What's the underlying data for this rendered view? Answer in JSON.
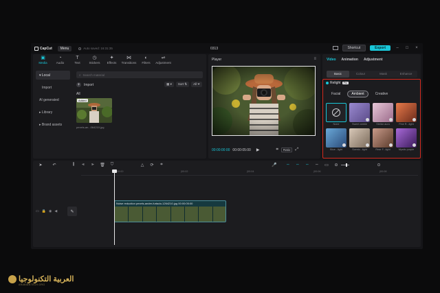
{
  "titlebar": {
    "app_name": "CapCut",
    "menu_label": "Menu",
    "autosave_text": "Auto saved: 16:31:35",
    "project_name": "0313",
    "shortcut_label": "Shortcut",
    "export_label": "Export"
  },
  "media": {
    "tabs": [
      {
        "label": "Media",
        "icon": "media-icon"
      },
      {
        "label": "Audio",
        "icon": "audio-icon"
      },
      {
        "label": "Text",
        "icon": "text-icon"
      },
      {
        "label": "Stickers",
        "icon": "sticker-icon"
      },
      {
        "label": "Effects",
        "icon": "effects-icon"
      },
      {
        "label": "Transitions",
        "icon": "transitions-icon"
      },
      {
        "label": "Filters",
        "icon": "filters-icon"
      },
      {
        "label": "Adjustment",
        "icon": "adjustment-icon"
      }
    ],
    "sidebar": [
      "Local",
      "Import",
      "AI generated",
      "Library",
      "Brand assets"
    ],
    "search_placeholder": "Search material",
    "import_label": "Import",
    "sort_label": "Sort",
    "all_filter_label": "All",
    "all_label": "All",
    "thumb_badge": "Added",
    "thumb_name": "pexels-an...064210.jpg"
  },
  "player": {
    "title": "Player",
    "timecode_current": "00:00:00:00",
    "timecode_total": "00:00:05:00",
    "ratio_label": "Ratio"
  },
  "right_panel": {
    "tabs": [
      "Video",
      "Animation",
      "Adjustment"
    ],
    "subtabs": [
      "Basic",
      "Colour",
      "Mask",
      "Enhance"
    ],
    "relight_label": "Relight",
    "relight_badge": "Pro",
    "modes": [
      "Facial",
      "Ambient",
      "Creative"
    ],
    "presets": [
      {
        "label": "None",
        "color": "#222226"
      },
      {
        "label": "Sweet  ambie",
        "color": "#7a6aa8"
      },
      {
        "label": "Stellar  aura",
        "color": "#c89ab8"
      },
      {
        "label": "Fine R...light",
        "color": "#c85a3a"
      },
      {
        "label": "Blue...light",
        "color": "#4a7aa8"
      },
      {
        "label": "Scenic...light",
        "color": "#b8a89a"
      },
      {
        "label": "Rear F...light",
        "color": "#a87a6a"
      },
      {
        "label": "Mystic  purple",
        "color": "#7a4aa8"
      }
    ]
  },
  "timeline": {
    "ticks": [
      "00:00",
      "|00:02",
      "|00:04",
      "|00:06",
      "|00:08"
    ],
    "clip_label": "Noise reduction   pexels-andre-furtado-1264210.jpg   00:00:05:00"
  },
  "watermark": {
    "text": "العربية التكنولوجيا",
    "sub": "ARABIANTECH.ORG"
  }
}
